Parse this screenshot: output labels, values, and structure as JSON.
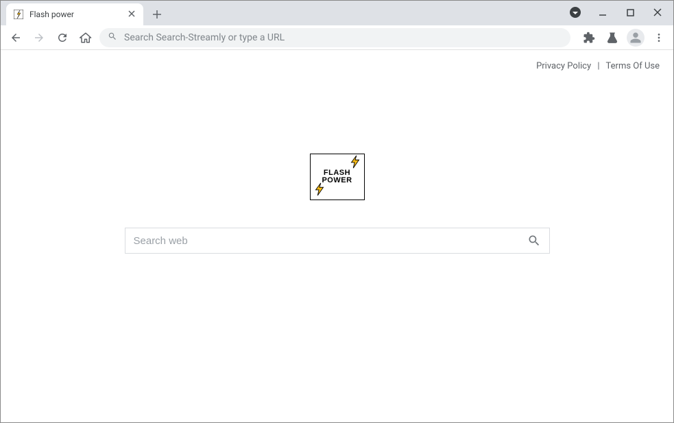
{
  "tab": {
    "title": "Flash power"
  },
  "omnibox": {
    "placeholder": "Search Search-Streamly or type a URL"
  },
  "page": {
    "links": {
      "privacy": "Privacy Policy",
      "separator": "|",
      "terms": "Terms Of Use"
    },
    "logo": {
      "line1": "FLASH",
      "line2": "POWER"
    },
    "search": {
      "placeholder": "Search web"
    }
  }
}
